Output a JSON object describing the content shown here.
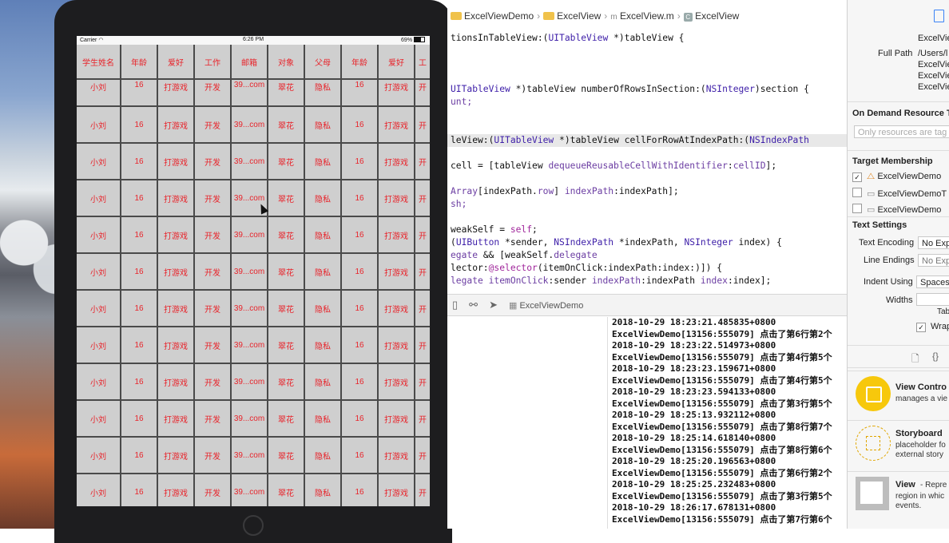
{
  "jumpbar": {
    "items": [
      "ExcelViewDemo",
      "ExcelView",
      "ExcelView.m",
      "ExcelView"
    ]
  },
  "simulator": {
    "carrier": "Carrier",
    "time": "6:26 PM",
    "battery": "69%",
    "headers": [
      "学生姓名",
      "年龄",
      "爱好",
      "工作",
      "邮箱",
      "对象",
      "父母",
      "年龄",
      "爱好",
      "工"
    ],
    "row_values": [
      "小刘",
      "16",
      "打游戏",
      "开发",
      "39...com",
      "翠花",
      "隐私",
      "16",
      "打游戏",
      "开"
    ],
    "row_count": 12
  },
  "code_lines": [
    [
      [
        "tionsInTableView:(",
        ""
      ],
      [
        "UITableView",
        "ty"
      ],
      [
        " *)tableView {",
        ""
      ]
    ],
    [
      [
        "",
        ""
      ]
    ],
    [
      [
        "",
        ""
      ]
    ],
    [
      [
        "",
        ""
      ]
    ],
    [
      [
        "UITableView",
        "ty"
      ],
      [
        " *)tableView numberOfRowsInSection:(",
        ""
      ],
      [
        "NSInteger",
        "ty"
      ],
      [
        ")section {",
        ""
      ]
    ],
    [
      [
        "unt;",
        "pf"
      ]
    ],
    [
      [
        "",
        ""
      ]
    ],
    [
      [
        "",
        ""
      ]
    ],
    [
      [
        "leView:(",
        ""
      ],
      [
        "UITableView",
        "ty"
      ],
      [
        " *)tableView cellForRowAtIndexPath:(",
        ""
      ],
      [
        "NSIndexPath",
        "ty"
      ]
    ],
    [
      [
        "",
        ""
      ]
    ],
    [
      [
        "cell = [tableView ",
        ""
      ],
      [
        "dequeueReusableCellWithIdentifier",
        "pf"
      ],
      [
        ":",
        ""
      ],
      [
        "cellID",
        "pf"
      ],
      [
        "];",
        ""
      ]
    ],
    [
      [
        "",
        ""
      ]
    ],
    [
      [
        "Array",
        "pf"
      ],
      [
        "[indexPath.",
        ""
      ],
      [
        "row",
        "pf"
      ],
      [
        "] ",
        ""
      ],
      [
        "indexPath",
        "pf"
      ],
      [
        ":indexPath];",
        ""
      ]
    ],
    [
      [
        "sh;",
        "pf"
      ]
    ],
    [
      [
        "",
        ""
      ]
    ],
    [
      [
        "weakSelf = ",
        ""
      ],
      [
        "self",
        "kw"
      ],
      [
        ";",
        ""
      ]
    ],
    [
      [
        "(",
        ""
      ],
      [
        "UIButton",
        "ty"
      ],
      [
        " *sender, ",
        ""
      ],
      [
        "NSIndexPath",
        "ty"
      ],
      [
        " *indexPath, ",
        ""
      ],
      [
        "NSInteger",
        "ty"
      ],
      [
        " index) {",
        ""
      ]
    ],
    [
      [
        "egate",
        "pf"
      ],
      [
        " && [weakSelf.",
        ""
      ],
      [
        "delegate",
        "pf"
      ]
    ],
    [
      [
        "lector:",
        ""
      ],
      [
        "@selector",
        "kw"
      ],
      [
        "(itemOnClick:indexPath:index:)]) {",
        ""
      ]
    ],
    [
      [
        "legate",
        "pf"
      ],
      [
        " ",
        ""
      ],
      [
        "itemOnClick",
        "pf"
      ],
      [
        ":sender ",
        ""
      ],
      [
        "indexPath",
        "pf"
      ],
      [
        ":indexPath ",
        ""
      ],
      [
        "index",
        "pf"
      ],
      [
        ":index];",
        ""
      ]
    ]
  ],
  "debug_bar": {
    "target": "ExcelViewDemo"
  },
  "console_lines": [
    "2018-10-29 18:23:21.485835+0800",
    "ExcelViewDemo[13156:555079] 点击了第6行第2个",
    "2018-10-29 18:23:22.514973+0800",
    "ExcelViewDemo[13156:555079] 点击了第4行第5个",
    "2018-10-29 18:23:23.159671+0800",
    "ExcelViewDemo[13156:555079] 点击了第4行第5个",
    "2018-10-29 18:23:23.594133+0800",
    "ExcelViewDemo[13156:555079] 点击了第3行第5个",
    "2018-10-29 18:25:13.932112+0800",
    "ExcelViewDemo[13156:555079] 点击了第8行第7个",
    "2018-10-29 18:25:14.618140+0800",
    "ExcelViewDemo[13156:555079] 点击了第8行第6个",
    "2018-10-29 18:25:20.196563+0800",
    "ExcelViewDemo[13156:555079] 点击了第6行第2个",
    "2018-10-29 18:25:25.232483+0800",
    "ExcelViewDemo[13156:555079] 点击了第3行第5个",
    "2018-10-29 18:26:17.678131+0800",
    "ExcelViewDemo[13156:555079] 点击了第7行第6个"
  ],
  "inspector": {
    "name_value": "ExcelVie",
    "full_path_label": "Full Path",
    "full_path_value": "/Users/l",
    "full_path_lines": [
      "ExcelVie",
      "ExcelVie",
      "ExcelVie"
    ],
    "on_demand_title": "On Demand Resource Ta",
    "on_demand_placeholder": "Only resources are tag",
    "target_membership_title": "Target Membership",
    "targets": [
      {
        "label": "ExcelViewDemo",
        "checked": true
      },
      {
        "label": "ExcelViewDemoT",
        "checked": false
      },
      {
        "label": "ExcelViewDemo",
        "checked": false
      }
    ],
    "text_settings_title": "Text Settings",
    "text_encoding_label": "Text Encoding",
    "text_encoding_value": "No Exp",
    "line_endings_label": "Line Endings",
    "line_endings_value": "No Exp",
    "indent_using_label": "Indent Using",
    "indent_using_value": "Spaces",
    "widths_label": "Widths",
    "tab_label": "Tab",
    "wrap_label": "Wrap",
    "library": [
      {
        "title": "View Contro",
        "desc": [
          "manages a vie"
        ]
      },
      {
        "title": "Storyboard",
        "desc": [
          "placeholder fo",
          "external story"
        ]
      },
      {
        "title": "View",
        "desc": [
          "- Repre",
          "region in whic",
          "events."
        ]
      }
    ]
  }
}
